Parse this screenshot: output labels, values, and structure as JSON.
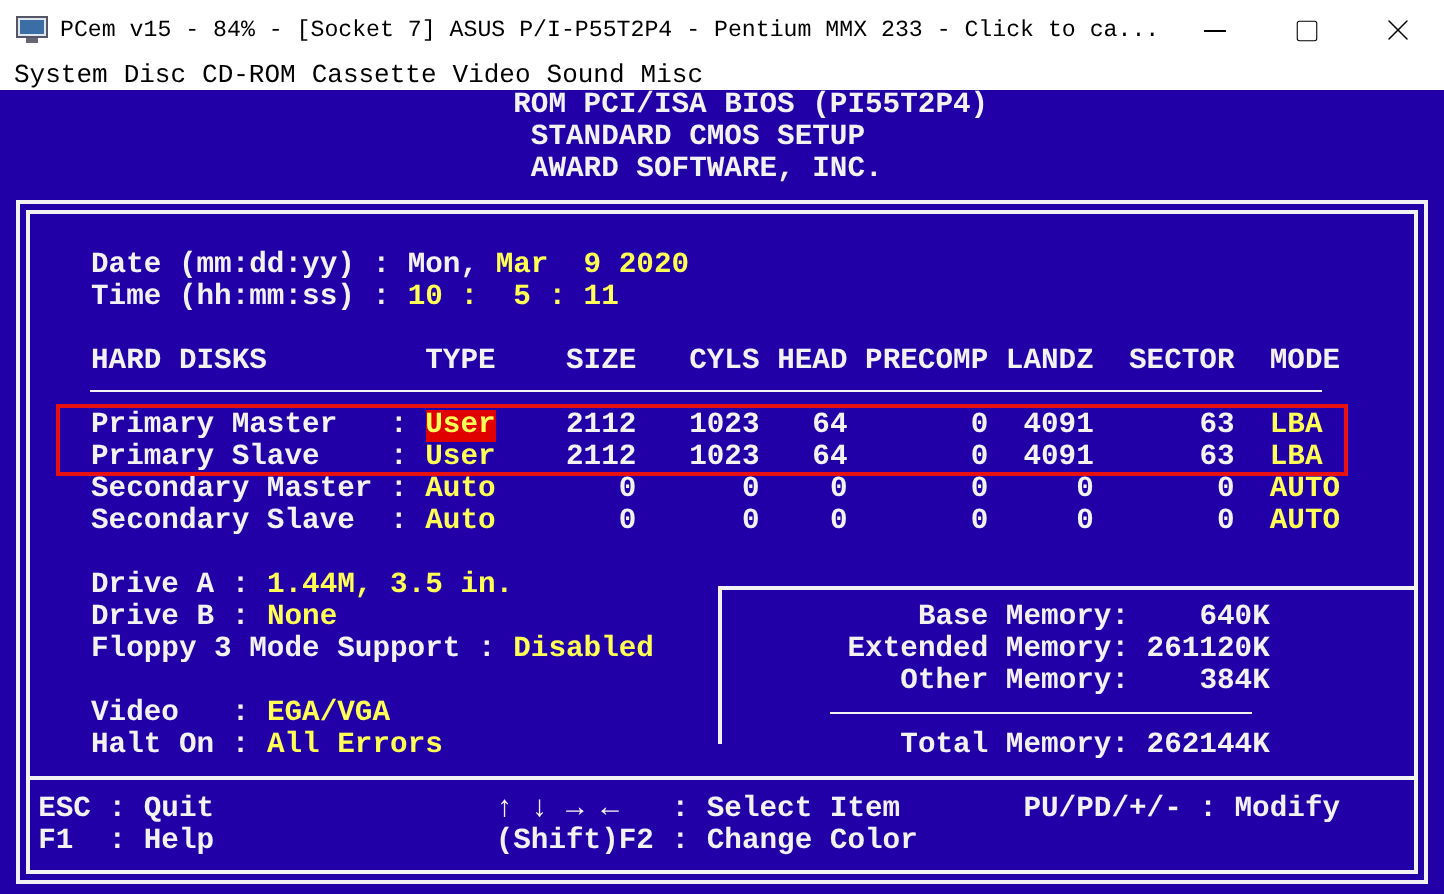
{
  "window": {
    "title": "PCem v15 - 84% - [Socket 7] ASUS P/I-P55T2P4 - Pentium MMX 233 - Click to ca..."
  },
  "menu": [
    "System",
    "Disc",
    "CD-ROM",
    "Cassette",
    "Video",
    "Sound",
    "Misc"
  ],
  "bios": {
    "titles": [
      "ROM PCI/ISA BIOS (PI55T2P4)",
      "STANDARD CMOS SETUP",
      "AWARD SOFTWARE, INC."
    ],
    "date": {
      "label": "Date (mm:dd:yy) :",
      "weekday": "Mon,",
      "value": "Mar  9 2020"
    },
    "time": {
      "label": "Time (hh:mm:ss) :",
      "value": "10 :  5 : 11"
    },
    "disk_columns": [
      "HARD DISKS",
      "TYPE",
      "SIZE",
      "CYLS",
      "HEAD",
      "PRECOMP",
      "LANDZ",
      "SECTOR",
      "MODE"
    ],
    "disks": [
      {
        "label": "Primary Master   :",
        "type": "User",
        "size": "2112",
        "cyls": "1023",
        "head": "64",
        "precomp": "0",
        "landz": "4091",
        "sector": "63",
        "mode": "LBA",
        "selected": true,
        "marked": true
      },
      {
        "label": "Primary Slave    :",
        "type": "User",
        "size": "2112",
        "cyls": "1023",
        "head": "64",
        "precomp": "0",
        "landz": "4091",
        "sector": "63",
        "mode": "LBA",
        "selected": false,
        "marked": true
      },
      {
        "label": "Secondary Master :",
        "type": "Auto",
        "size": "0",
        "cyls": "0",
        "head": "0",
        "precomp": "0",
        "landz": "0",
        "sector": "0",
        "mode": "AUTO",
        "selected": false,
        "marked": false
      },
      {
        "label": "Secondary Slave  :",
        "type": "Auto",
        "size": "0",
        "cyls": "0",
        "head": "0",
        "precomp": "0",
        "landz": "0",
        "sector": "0",
        "mode": "AUTO",
        "selected": false,
        "marked": false
      }
    ],
    "settings": [
      {
        "label": "Drive A :",
        "value": "1.44M, 3.5 in."
      },
      {
        "label": "Drive B :",
        "value": "None"
      },
      {
        "label": "Floppy 3 Mode Support :",
        "value": "Disabled"
      },
      {
        "label": "Video   :",
        "value": "EGA/VGA"
      },
      {
        "label": "Halt On :",
        "value": "All Errors"
      }
    ],
    "memory": [
      {
        "label": "Base Memory:",
        "value": "640K"
      },
      {
        "label": "Extended Memory:",
        "value": "261120K"
      },
      {
        "label": "Other Memory:",
        "value": "384K"
      },
      {
        "label": "Total Memory:",
        "value": "262144K"
      }
    ],
    "help": [
      "ESC : Quit",
      "F1  : Help",
      "↑ ↓ → ←   : Select Item",
      "(Shift)F2 : Change Color",
      "PU/PD/+/- : Modify"
    ]
  }
}
